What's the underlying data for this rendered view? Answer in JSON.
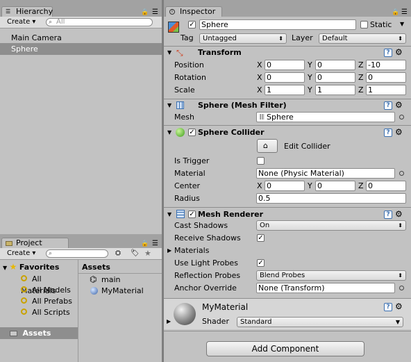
{
  "hierarchy": {
    "tab": "Hierarchy",
    "create": "Create ▾",
    "search_placeholder": "All",
    "items": [
      "Main Camera",
      "Sphere"
    ]
  },
  "project": {
    "tab": "Project",
    "create": "Create ▾",
    "favorites_label": "Favorites",
    "favorites": [
      "All Materials",
      "All Models",
      "All Prefabs",
      "All Scripts"
    ],
    "assets_tree": "Assets",
    "assets_header": "Assets",
    "assets": [
      "main",
      "MyMaterial"
    ]
  },
  "inspector": {
    "tab": "Inspector",
    "object_name": "Sphere",
    "static_label": "Static",
    "tag_label": "Tag",
    "tag_value": "Untagged",
    "layer_label": "Layer",
    "layer_value": "Default",
    "transform": {
      "title": "Transform",
      "rows": [
        {
          "label": "Position",
          "x": "0",
          "y": "0",
          "z": "-10"
        },
        {
          "label": "Rotation",
          "x": "0",
          "y": "0",
          "z": "0"
        },
        {
          "label": "Scale",
          "x": "1",
          "y": "1",
          "z": "1"
        }
      ]
    },
    "mesh_filter": {
      "title": "Sphere (Mesh Filter)",
      "mesh_label": "Mesh",
      "mesh_value": "Sphere"
    },
    "collider": {
      "title": "Sphere Collider",
      "edit_label": "Edit Collider",
      "is_trigger_label": "Is Trigger",
      "material_label": "Material",
      "material_value": "None (Physic Material)",
      "center_label": "Center",
      "center": {
        "x": "0",
        "y": "0",
        "z": "0"
      },
      "radius_label": "Radius",
      "radius_value": "0.5"
    },
    "renderer": {
      "title": "Mesh Renderer",
      "cast_shadows_label": "Cast Shadows",
      "cast_shadows_value": "On",
      "receive_shadows_label": "Receive Shadows",
      "materials_label": "Materials",
      "light_probes_label": "Use Light Probes",
      "reflection_label": "Reflection Probes",
      "reflection_value": "Blend Probes",
      "anchor_label": "Anchor Override",
      "anchor_value": "None (Transform)"
    },
    "material": {
      "name": "MyMaterial",
      "shader_label": "Shader",
      "shader_value": "Standard"
    },
    "add_component": "Add Component",
    "axis": {
      "x": "X",
      "y": "Y",
      "z": "Z"
    },
    "check_mark": "✓"
  }
}
